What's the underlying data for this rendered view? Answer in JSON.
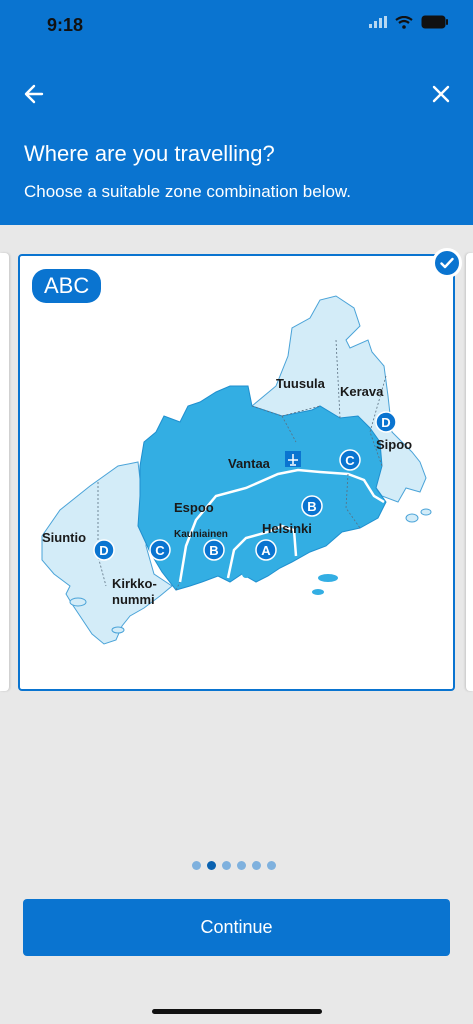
{
  "status_bar": {
    "time": "9:18"
  },
  "header": {
    "title": "Where are you travelling?",
    "subtitle": "Choose a suitable zone combination below."
  },
  "card": {
    "zone_label": "ABC",
    "map_labels": {
      "tuusula": "Tuusula",
      "kerava": "Kerava",
      "sipoo": "Sipoo",
      "vantaa": "Vantaa",
      "espoo": "Espoo",
      "kauniainen": "Kauniainen",
      "helsinki": "Helsinki",
      "siuntio": "Siuntio",
      "kirkkonummi_1": "Kirkko-",
      "kirkkonummi_2": "nummi"
    },
    "zone_markers": {
      "a": "A",
      "b": "B",
      "c": "C",
      "d": "D"
    }
  },
  "pagination": {
    "count": 6,
    "active_index": 1
  },
  "continue_label": "Continue",
  "colors": {
    "primary": "#0a74d0",
    "zone_abc": "#33aee3",
    "zone_d": "#d3ecf8",
    "border": "#4aa3d8"
  }
}
